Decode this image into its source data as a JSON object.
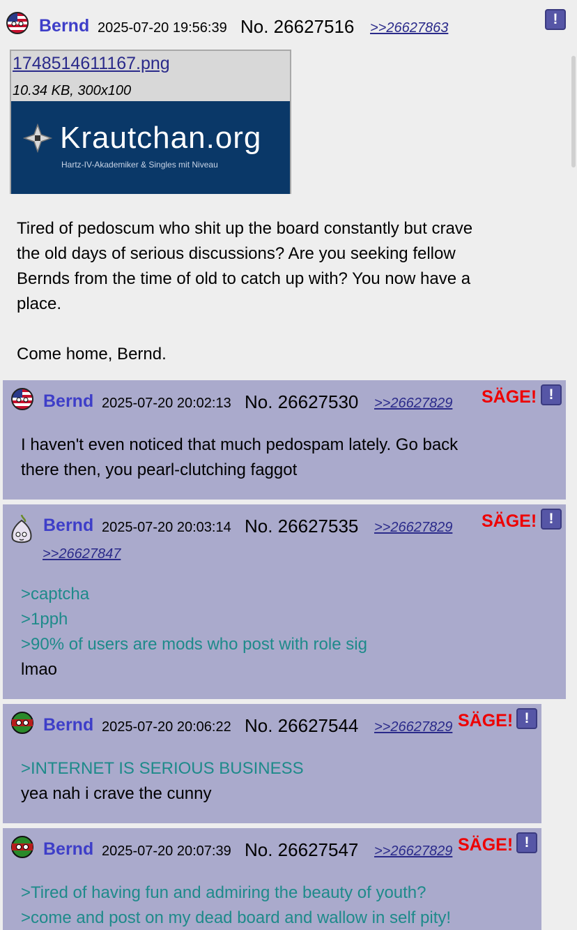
{
  "op": {
    "name": "Bernd",
    "timestamp": "2025-07-20 19:56:39",
    "post_no": "No. 26627516",
    "backlinks": [
      ">>26627863"
    ],
    "file": {
      "filename": "1748514611167.png",
      "meta": "10.34 KB, 300x100",
      "thumb_title": "Krautchan.org",
      "thumb_subtitle": "Hartz-IV-Akademiker & Singles mit Niveau"
    },
    "lines": [
      "Tired of pedoscum who shit up the board constantly but crave",
      "the old days of serious discussions? Are you seeking fellow",
      "Bernds from the time of old to catch up with? You now have a",
      "place.",
      "Come home, Bernd."
    ],
    "report_label": "!"
  },
  "replies": [
    {
      "name": "Bernd",
      "timestamp": "2025-07-20 20:02:13",
      "post_no": "No. 26627530",
      "backlinks": [
        ">>26627829"
      ],
      "sage": "SÄGE!",
      "report_label": "!",
      "lines": [
        "I haven't even noticed that much pedospam lately. Go back",
        "there then, you pearl-clutching faggot"
      ]
    },
    {
      "name": "Bernd",
      "timestamp": "2025-07-20 20:03:14",
      "post_no": "No. 26627535",
      "backlinks": [
        ">>26627829",
        ">>26627847"
      ],
      "sage": "SÄGE!",
      "report_label": "!",
      "lines": [
        ">captcha",
        ">1pph",
        ">90% of users are mods who post with role sig",
        "lmao"
      ]
    },
    {
      "name": "Bernd",
      "timestamp": "2025-07-20 20:06:22",
      "post_no": "No. 26627544",
      "backlinks": [
        ">>26627829"
      ],
      "sage": "SÄGE!",
      "report_label": "!",
      "lines": [
        ">INTERNET IS SERIOUS BUSINESS",
        "yea nah i crave the cunny"
      ]
    },
    {
      "name": "Bernd",
      "timestamp": "2025-07-20 20:07:39",
      "post_no": "No. 26627547",
      "backlinks": [
        ">>26627829"
      ],
      "sage": "SÄGE!",
      "report_label": "!",
      "lines": [
        ">Tired of having fun and admiring the beauty of youth?",
        ">come and post on my dead board and wallow in self pity!"
      ]
    }
  ],
  "colors": {
    "background": "#eeeeee",
    "reply_background": "#aaaacc",
    "poster_name": "#3e3ec8",
    "sage": "#ee0000",
    "greentext": "#1e8a8a",
    "link": "#2a2a8a"
  },
  "icons": [
    "us-flag-icon",
    "onion-flag-icon",
    "green-ball-flag-icon",
    "report-icon",
    "iron-cross-icon"
  ]
}
